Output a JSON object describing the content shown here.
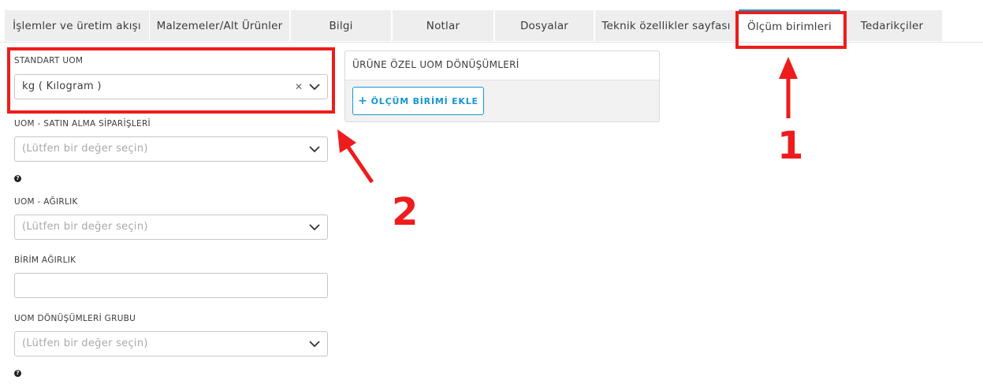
{
  "tabs": [
    {
      "label": "İşlemler ve üretim akışı",
      "active": false
    },
    {
      "label": "Malzemeler/Alt Ürünler",
      "active": false
    },
    {
      "label": "Bilgi",
      "active": false
    },
    {
      "label": "Notlar",
      "active": false
    },
    {
      "label": "Dosyalar",
      "active": false
    },
    {
      "label": "Teknik özellikler sayfası",
      "active": false
    },
    {
      "label": "Ölçüm birimleri",
      "active": true
    },
    {
      "label": "Tedarikçiler",
      "active": false
    }
  ],
  "form": {
    "standard_uom": {
      "label": "STANDART UOM",
      "value": "kg ( Kılogram )",
      "clear_icon": "clear-icon",
      "chevron_icon": "chevron-down-icon"
    },
    "purchase_uom": {
      "label": "UOM - SATIN ALMA SİPARİŞLERİ",
      "placeholder": "(Lütfen bir değer seçin)"
    },
    "help_icon_glyph": "?",
    "weight_uom": {
      "label": "UOM - AĞIRLIK",
      "placeholder": "(Lütfen bir değer seçin)"
    },
    "unit_weight": {
      "label": "BİRİM AĞIRLIK",
      "value": ""
    },
    "conversion_group": {
      "label": "UOM DÖNÜŞÜMLERİ GRUBU",
      "placeholder": "(Lütfen bir değer seçin)"
    }
  },
  "conversions_panel": {
    "title": "ÜRÜNE ÖZEL UOM DÖNÜŞÜMLERİ",
    "add_button_icon": "+",
    "add_button_label": "ÖLÇÜM BİRİMİ EKLE"
  },
  "annotations": {
    "color": "#ee1c1c",
    "callout_1": "1",
    "callout_2": "2"
  },
  "colors": {
    "accent": "#1796d2",
    "tab_background": "#eeeeee",
    "panel_background": "#f2f2f2"
  }
}
